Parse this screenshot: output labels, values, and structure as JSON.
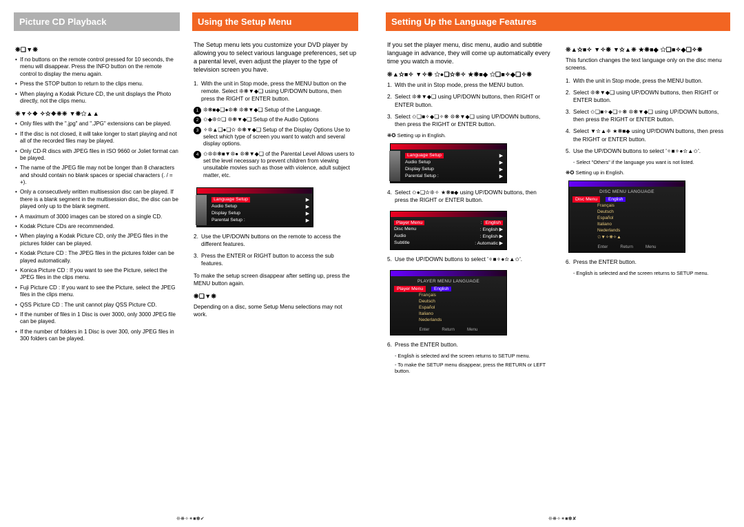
{
  "left_page": {
    "col1_title": "Picture CD Playback",
    "note_hdr": "❋❏▼❋",
    "notes": [
      "If no buttons on the remote control pressed for 10 seconds, the menu will disappear. Press the INFO button on the remote control to display the menu again.",
      "Press the STOP button to return to the clips menu.",
      "When playing a Kodak Picture CD, the unit displays the Photo directly, not the clips menu."
    ],
    "cdr_hdr": "❈▼✧❖ ✧✫❖❈❈ ▼❋✩▲▲",
    "cdr_notes": [
      "Only files with the \".jpg\" and \".JPG\" extensions can be played.",
      "If the disc is not closed, it will take longer to start playing and not all of the recorded files may be played.",
      "Only CD-R discs with JPEG files in ISO 9660 or Joliet format can be played.",
      "The name of the JPEG file may not be longer than 8 characters and should contain no blank spaces or special characters (. / = +).",
      "Only a consecutively written multisession disc can be played. If there is a blank segment in the multisession disc, the disc can be played only up to the blank segment.",
      "A maximum of 3000 images can be stored on a single CD.",
      "Kodak Picture CDs are recommended.",
      "When playing a Kodak Picture CD, only the JPEG files in the pictures folder can be played.",
      "Kodak Picture CD : The JPEG files in the pictures folder can be played automatically.",
      "Konica Picture CD : If you want to see the Picture, select the JPEG files in the clips menu.",
      "Fuji Picture CD : If you want to see the Picture, select the JPEG files in the clips menu.",
      "QSS Picture CD : The unit cannot play QSS Picture CD.",
      "If the number of files in 1 Disc is over 3000, only 3000 JPEG file can be played.",
      "If the number of folders in 1 Disc is over 300, only JPEG files in 300 folders can be played."
    ],
    "col2_title": "Using the Setup Menu",
    "setup_intro": "The Setup menu lets you customize your DVD player by allowing you to select various language preferences, set up a parental level, even adjust the player to the type of television screen you have.",
    "setup_step1": "With the unit in Stop mode, press the MENU button on the remote. Select ❊❋▼◆❑ using UP/DOWN buttons, then press the RIGHT or ENTER button.",
    "setup_items": [
      "❊❋■◆❑●❊❋ ❊❋▼◆❑ Setup of the Language.",
      "✩◆❊✫❏ ❊❋▼◆❑ Setup of the Audio Options",
      "✧❊▲❑●❏✫ ❊❋▼◆❑ Setup of the Display Options Use to select which type of screen you want to watch and several display options.",
      "✩❊❊❋■▼❊● ❊❋▼◆❑ of the Parental Level Allows users to set the level necessary to prevent children from viewing unsuitable movies such as those with violence, adult subject matter, etc."
    ],
    "setup_step2": "Use the UP/DOWN buttons on the remote to access the different features.",
    "setup_step3": "Press the ENTER or RIGHT button to access the sub features.",
    "setup_close": "To make the setup screen disappear after setting up, press the MENU button again.",
    "setup_note_hdr": "❋❏▼❋",
    "setup_note": "Depending on a disc, some Setup Menu selections may not work.",
    "osd1": {
      "rows": [
        "Language Setup",
        "Audio Setup",
        "Display Setup",
        "Parental Setup :"
      ],
      "hl_idx": 0
    },
    "page_num": "❊❋✧✴■✽✔"
  },
  "right_page": {
    "title": "Setting Up the Language Features",
    "intro": "If you set the player menu, disc menu, audio and subtitle language in advance, they will come up automatically every time you watch a movie.",
    "player_hdr": "❊▲✫■✧ ▼✧❋ ✩●❏✫❊✧ ★❋■◆ ✩❏■✧◆❏✧❋",
    "player_steps": [
      "With the unit in Stop mode, press the MENU button.",
      "Select ❊❋▼◆❑ using UP/DOWN buttons, then RIGHT or ENTER button.",
      "Select ✩❏■✧◆❏✧❋ ❊❋▼◆❑ using UP/DOWN buttons, then press the RIGHT or ENTER button."
    ],
    "ex1": "❋✪ Setting up in English.",
    "osd2": {
      "rows": [
        "Language Setup",
        "Audio Setup",
        "Display Setup",
        "Parental Setup :"
      ],
      "hl_idx": 0
    },
    "player_step4": "Select ✩●❏✫❊✧ ★❋■◆ using UP/DOWN buttons, then press the RIGHT or ENTER button.",
    "osd3": {
      "left": "Player Menu",
      "rows": [
        [
          "Disc Menu",
          "English"
        ],
        [
          "Audio",
          "English"
        ],
        [
          "Subtitle",
          "Automatic"
        ]
      ],
      "hl_val": "English"
    },
    "player_step5": "Use the UP/DOWN buttons to select '✧■✧●✫▲✩'.",
    "osd4": {
      "title": "PLAYER MENU LANGUAGE",
      "left": "Player Menu",
      "langs": [
        "English",
        "Français",
        "Deutsch",
        "Español",
        "Italiano",
        "Nederlands"
      ]
    },
    "player_step6": "Press the ENTER button.",
    "player_notes": [
      "English is selected and the screen returns to SETUP menu.",
      "To make the SETUP menu disappear, press the RETURN or LEFT button."
    ],
    "disc_hdr": "❊▲✫■✧ ▼✧❋ ▼✫▲❈ ★❋■◆ ✩❏■✧◆❏✧❋",
    "disc_intro": "This function changes the text language only on the disc menu screens.",
    "disc_steps": [
      "With the unit in Stop mode, press the MENU button.",
      "Select ❊❋▼◆❑ using UP/DOWN buttons, then RIGHT or ENTER button.",
      "Select ✩❏■✧◆❏✧❋ ❊❋▼◆❑ using UP/DOWN buttons, then press the RIGHT or ENTER button.",
      "Select ▼✫▲❈ ★❋■◆ using UP/DOWN buttons, then press the RIGHT or ENTER button.",
      "Use the UP/DOWN buttons to select '✧■✧●✫▲✩'."
    ],
    "disc_note5": "Select \"Others\" if the language you want is not listed.",
    "ex2": "❋✪ Setting up in English.",
    "osd5": {
      "title": "DISC MENU LANGUAGE",
      "left": "Disc Menu",
      "langs": [
        "English",
        "Français",
        "Deutsch",
        "Español",
        "Italiano",
        "Nederlands",
        "✩▼✧❋✧▲"
      ]
    },
    "disc_step6": "Press the ENTER button.",
    "disc_notes": [
      "English is selected and the screen returns to SETUP menu."
    ],
    "page_num": "❊❋✧✴■✽✘"
  }
}
